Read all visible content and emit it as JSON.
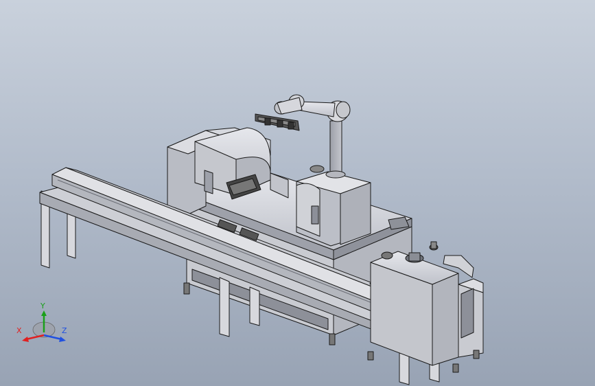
{
  "triad": {
    "x_label": "X",
    "y_label": "Y",
    "z_label": "Z",
    "x_color": "#e02020",
    "y_color": "#1aa01a",
    "z_color": "#2050e0"
  },
  "colors": {
    "background_top": "#c9d1dc",
    "background_bottom": "#98a3b4",
    "part_face": "#d2d4da",
    "part_shade": "#a9acb6",
    "edge": "#1a1a1a"
  }
}
